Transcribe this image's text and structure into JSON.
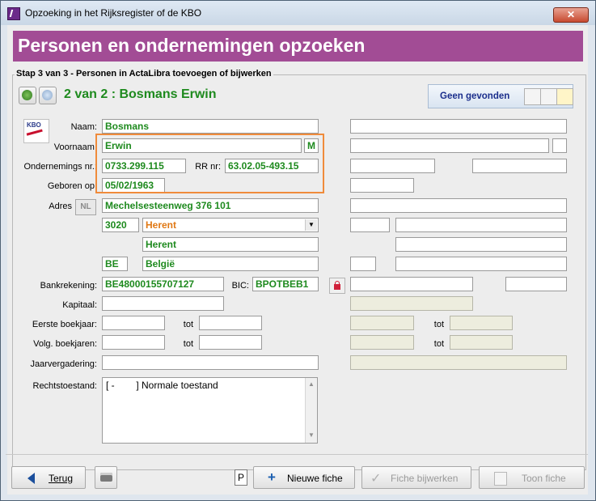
{
  "window": {
    "title": "Opzoeking in het Rijksregister of de KBO",
    "close_symbol": "✕"
  },
  "banner": {
    "title": "Personen en ondernemingen opzoeken"
  },
  "step": {
    "label": "Stap 3 van 3 - Personen in ActaLibra toevoegen of bijwerken"
  },
  "record": {
    "title": "2 van 2 : Bosmans Erwin",
    "status": "Geen gevonden"
  },
  "kbo_logo": {
    "text": "KBO"
  },
  "labels": {
    "naam": "Naam:",
    "voornaam": "Voornaam:",
    "ondernemingsnr": "Ondernemings nr.:",
    "rrnr": "RR nr:",
    "geboren": "Geboren op:",
    "adres": "Adres",
    "bankrekening": "Bankrekening:",
    "bic": "BIC:",
    "kapitaal": "Kapitaal:",
    "eerste_boekjaar": "Eerste boekjaar:",
    "volg_boekjaren": "Volg. boekjaren:",
    "jaarvergadering": "Jaarvergadering:",
    "rechtstoestand": "Rechtstoestand:",
    "tot": "tot"
  },
  "fields": {
    "naam": "Bosmans",
    "voornaam": "Erwin",
    "geslacht": "M",
    "ondernemingsnr": "0733.299.115",
    "rrnr": "63.02.05-493.15",
    "geboren": "05/02/1963",
    "adres": "Mechelsesteenweg 376 101",
    "postcode": "3020",
    "gemeente_select": "Herent",
    "gemeente": "Herent",
    "landcode": "BE",
    "land": "België",
    "bankrekening": "BE48000155707127",
    "bic": "BPOTBEB1",
    "rechtstoestand": "[ -        ] Normale toestand"
  },
  "address_lang_button": "NL",
  "buttons": {
    "terug": "Terug",
    "p_box": "P",
    "nieuwe_fiche": "Nieuwe fiche",
    "fiche_bijwerken": "Fiche bijwerken",
    "toon_fiche": "Toon fiche"
  },
  "icons": {
    "app": "actalibra-app-icon",
    "nav_prev": "nav-back-icon",
    "nav_next": "nav-forward-icon",
    "search_person": "search-person-icon",
    "search_person2": "search-person-alt-icon",
    "lock_person": "lock-person-icon",
    "lock": "lock-icon",
    "printer": "printer-icon",
    "plus": "plus-icon",
    "check": "check-icon",
    "eye_card": "view-card-icon",
    "back_arrow": "back-arrow-icon"
  },
  "colors": {
    "banner": "#a24c95",
    "field_text": "#1e8a1e",
    "highlight": "#f08b3b",
    "select_text": "#e07814"
  }
}
